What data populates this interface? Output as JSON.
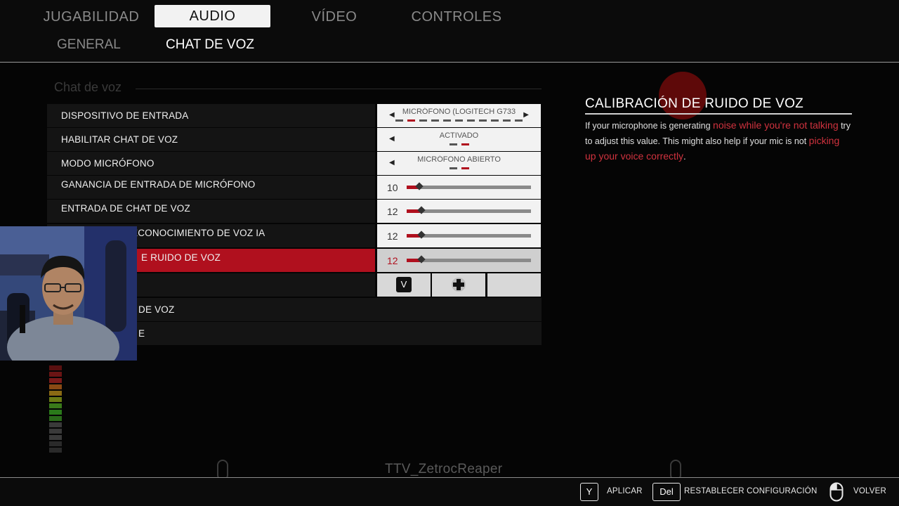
{
  "tabs": [
    "JUGABILIDAD",
    "AUDIO",
    "VÍDEO",
    "CONTROLES"
  ],
  "active_tab": "AUDIO",
  "subtabs": [
    "GENERAL",
    "CHAT DE VOZ"
  ],
  "active_subtab": "CHAT DE VOZ",
  "section_title": "Chat de voz",
  "rows": [
    {
      "label": "DISPOSITIVO DE ENTRADA",
      "value": "MICRÓFONO (LOGITECH G733"
    },
    {
      "label": "HABILITAR CHAT DE VOZ",
      "value": "ACTIVADO"
    },
    {
      "label": "MODO MICRÓFONO",
      "value": "MICRÓFONO ABIERTO"
    },
    {
      "label": "GANANCIA DE ENTRADA DE MICRÓFONO",
      "value": "10",
      "level": 10
    },
    {
      "label": "ENTRADA DE CHAT DE VOZ",
      "value": "12",
      "level": 12
    },
    {
      "label": "ECONOCIMIENTO DE VOZ IA",
      "value": "12",
      "level": 12
    },
    {
      "label": "E RUIDO DE VOZ",
      "value": "12",
      "level": 12
    },
    {
      "label": "",
      "key": "V"
    },
    {
      "label": "DE VOZ"
    },
    {
      "label": "E"
    }
  ],
  "info": {
    "title": "CALIBRACIÓN DE RUIDO DE VOZ",
    "text_1": "If your microphone is generating ",
    "highlight_1": "noise while you're not talking",
    "text_2": " try to adjust this value. This might also help if your mic is not ",
    "highlight_2": "picking up your voice correctly",
    "text_3": "."
  },
  "watermark": "TTV_ZetrocReaper",
  "footer": {
    "apply_key": "Y",
    "apply_label": "APLICAR",
    "reset_key": "Del",
    "reset_label": "RESTABLECER CONFIGURACIÓN",
    "back_label": "VOLVER"
  },
  "colors": {
    "accent": "#b0101e",
    "highlight": "#d0323e",
    "background": "#050505"
  }
}
